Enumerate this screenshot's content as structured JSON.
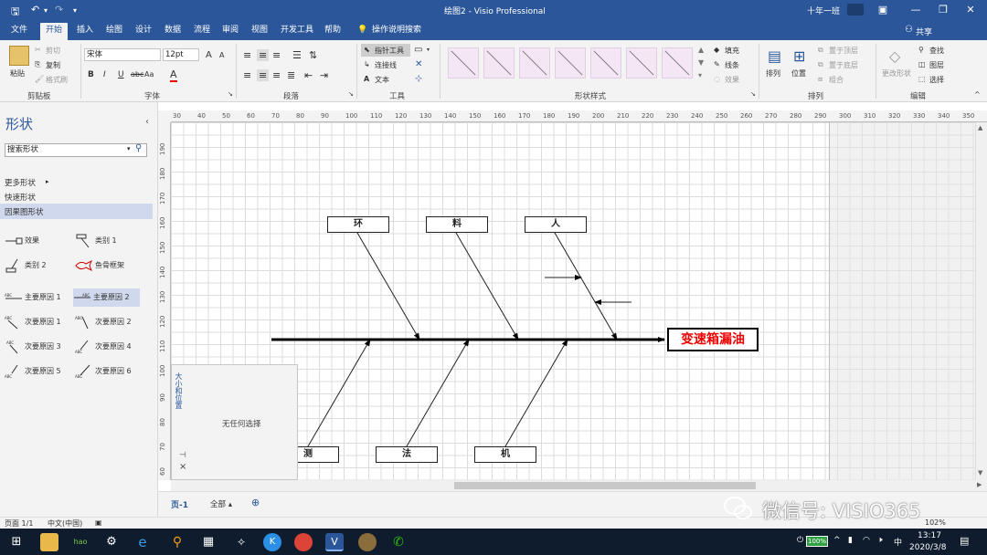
{
  "window": {
    "title": "绘图2 - Visio Professional",
    "user": "十年一班",
    "undo_icon": "undo-icon",
    "redo_icon": "redo-icon",
    "save_icon": "save-icon"
  },
  "tabs": [
    "文件",
    "开始",
    "插入",
    "绘图",
    "设计",
    "数据",
    "流程",
    "审阅",
    "视图",
    "开发工具",
    "帮助",
    "操作说明搜索"
  ],
  "share": "共享",
  "ribbon": {
    "clipboard": {
      "label": "剪贴板",
      "paste": "粘贴",
      "cut": "剪切",
      "copy": "复制",
      "format_painter": "格式刷"
    },
    "font": {
      "label": "字体",
      "font_name": "宋体",
      "font_size": "12pt",
      "bold": "B",
      "italic": "I",
      "underline": "U",
      "strike": "abc",
      "case": "Aa",
      "color": "A",
      "grow": "A",
      "shrink": "A"
    },
    "paragraph": {
      "label": "段落"
    },
    "tools": {
      "label": "工具",
      "pointer": "指针工具",
      "connector": "连接线",
      "text": "文本"
    },
    "shape_styles": {
      "label": "形状样式",
      "fill": "填充",
      "line": "线条",
      "effects": "效果"
    },
    "arrange": {
      "label": "排列",
      "align": "排列",
      "position": "位置",
      "bring_front": "置于顶层",
      "send_back": "置于底层",
      "group": "组合"
    },
    "editing": {
      "label": "编辑",
      "change_shape": "更改形状",
      "find": "查找",
      "layers": "图层",
      "select": "选择"
    }
  },
  "shapes_pane": {
    "title": "形状",
    "search_placeholder": "搜索形状",
    "more_shapes": "更多形状",
    "quick_shapes": "快速形状",
    "stencil": "因果图形状",
    "items": [
      "效果",
      "类别 1",
      "类别 2",
      "鱼骨框架",
      "主要原因 1",
      "主要原因 2",
      "次要原因 1",
      "次要原因 2",
      "次要原因 3",
      "次要原因 4",
      "次要原因 5",
      "次要原因 6"
    ]
  },
  "ruler": {
    "h_ticks": [
      "30",
      "40",
      "50",
      "60",
      "70",
      "80",
      "90",
      "100",
      "110",
      "120",
      "130",
      "140",
      "150",
      "160",
      "170",
      "180",
      "190",
      "200",
      "210",
      "220",
      "230",
      "240",
      "250",
      "260",
      "270",
      "280",
      "290",
      "300",
      "310",
      "320",
      "330",
      "340",
      "350"
    ],
    "v_ticks": [
      "190",
      "180",
      "170",
      "160",
      "150",
      "140",
      "130",
      "120",
      "110",
      "100",
      "90",
      "80",
      "70",
      "60"
    ]
  },
  "diagram": {
    "effect": "变速箱漏油",
    "top_causes": [
      "环",
      "料",
      "人"
    ],
    "bottom_causes": [
      "测",
      "法",
      "机"
    ]
  },
  "size_position": {
    "title": "大小和位置",
    "message": "无任何选择",
    "pin_icon": "pin-icon",
    "close": "×"
  },
  "page_tabs": {
    "current": "页-1",
    "all": "全部",
    "add": "⊕"
  },
  "status": {
    "page": "页面 1/1",
    "language": "中文(中国)",
    "zoom": "102%"
  },
  "taskbar": {
    "time": "13:17",
    "date": "2020/3/8",
    "ime": "中",
    "battery": "100%"
  },
  "watermark": "微信号: VISIO365",
  "colors": {
    "accent": "#2b579a",
    "effect_text": "#e00000",
    "taskbar": "#0f1c2e",
    "style_swatch": "#f4e6f4"
  }
}
